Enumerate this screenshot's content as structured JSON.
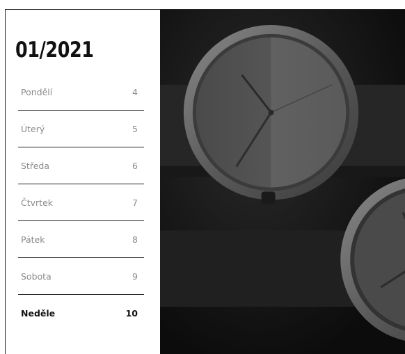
{
  "calendar": {
    "title": "01/2021",
    "days": [
      {
        "name": "Pondělí",
        "num": "4"
      },
      {
        "name": "Úterý",
        "num": "5"
      },
      {
        "name": "Středa",
        "num": "6"
      },
      {
        "name": "Čtvrtek",
        "num": "7"
      },
      {
        "name": "Pátek",
        "num": "8"
      },
      {
        "name": "Sobota",
        "num": "9"
      },
      {
        "name": "Neděle",
        "num": "10"
      }
    ],
    "active_index": 6
  },
  "photo": {
    "subject": "wristwatches-image",
    "colors": {
      "background": "#121212",
      "accent": "#6b6b6b"
    }
  }
}
